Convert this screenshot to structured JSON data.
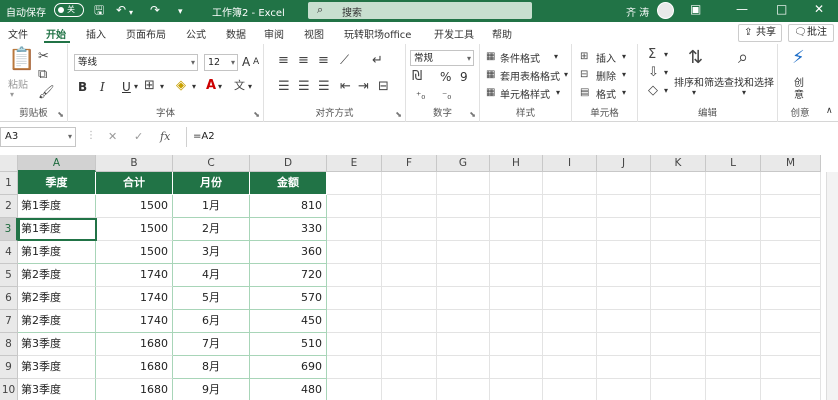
{
  "titlebar": {
    "autosave_label": "自动保存",
    "autosave_state": "关",
    "window_title": "工作簿2 - Excel",
    "search_placeholder": "搜索",
    "user_name": "齐 涛",
    "icons": [
      "save-icon",
      "undo-icon",
      "redo-icon",
      "customize-icon",
      "ribbon-display-icon",
      "minimize-icon",
      "restore-icon",
      "close-icon"
    ]
  },
  "tabs": [
    "文件",
    "开始",
    "插入",
    "页面布局",
    "公式",
    "数据",
    "审阅",
    "视图",
    "玩转职场office",
    "开发工具",
    "帮助"
  ],
  "active_tab": "开始",
  "share_label": "共享",
  "comment_label": "批注",
  "ribbon": {
    "clipboard": {
      "paste": "粘贴",
      "label": "剪贴板"
    },
    "font": {
      "name": "等线",
      "size": "12",
      "label": "字体",
      "bold": "B",
      "italic": "I",
      "underline": "U",
      "grow": "A",
      "shrink": "A"
    },
    "alignment": {
      "label": "对齐方式"
    },
    "number": {
      "format": "常规",
      "percent": "%",
      "comma": "9",
      "label": "数字"
    },
    "styles": {
      "conditional": "条件格式",
      "table": "套用表格格式",
      "cell": "单元格样式",
      "label": "样式"
    },
    "cells": {
      "insert": "插入",
      "delete": "删除",
      "format": "格式",
      "label": "单元格"
    },
    "editing": {
      "sort": "排序和筛选",
      "find": "查找和选择",
      "label": "编辑"
    },
    "ideas": {
      "create": "创",
      "create2": "意",
      "label": "创意"
    }
  },
  "formula_bar": {
    "name_box": "A3",
    "formula": "=A2",
    "cancel": "✕",
    "enter": "✓",
    "fx": "fx"
  },
  "columns": [
    "A",
    "B",
    "C",
    "D",
    "E",
    "F",
    "G",
    "H",
    "I",
    "J",
    "K",
    "L",
    "M"
  ],
  "rows": [
    "1",
    "2",
    "3",
    "4",
    "5",
    "6",
    "7",
    "8",
    "9",
    "10"
  ],
  "selected_cell": "A3",
  "table": {
    "headers": [
      "季度",
      "合计",
      "月份",
      "金额"
    ],
    "rows": [
      [
        "第1季度",
        "1500",
        "1月",
        "810"
      ],
      [
        "第1季度",
        "1500",
        "2月",
        "330"
      ],
      [
        "第1季度",
        "1500",
        "3月",
        "360"
      ],
      [
        "第2季度",
        "1740",
        "4月",
        "720"
      ],
      [
        "第2季度",
        "1740",
        "5月",
        "570"
      ],
      [
        "第2季度",
        "1740",
        "6月",
        "450"
      ],
      [
        "第3季度",
        "1680",
        "7月",
        "510"
      ],
      [
        "第3季度",
        "1680",
        "8月",
        "690"
      ],
      [
        "第3季度",
        "1680",
        "9月",
        "480"
      ]
    ]
  },
  "colors": {
    "accent": "#217346",
    "header_fill": "#217346",
    "header_text": "#ffffff"
  }
}
